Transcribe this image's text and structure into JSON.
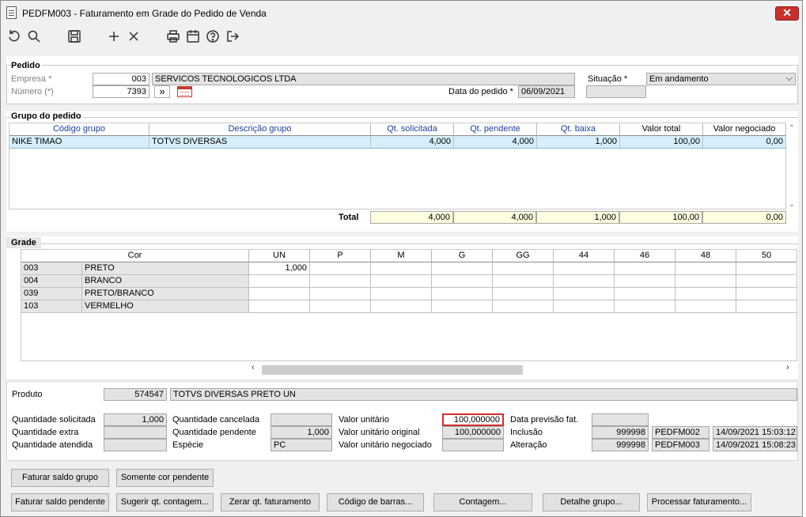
{
  "window": {
    "title": "PEDFM003 - Faturamento em Grade do Pedido de Venda",
    "close_label": "✕"
  },
  "toolbar": {
    "items": [
      "undo-icon",
      "search-icon",
      "save-icon",
      "add-icon",
      "delete-icon",
      "print-icon",
      "calendar-icon",
      "help-icon",
      "exit-icon"
    ]
  },
  "pedido": {
    "section_label": "Pedido",
    "empresa_label": "Empresa *",
    "empresa_code": "003",
    "empresa_name": "SERVICOS TECNOLOGICOS LTDA",
    "numero_label": "Número (*)",
    "numero_value": "7393",
    "nav_label": "»",
    "situacao_label": "Situação *",
    "situacao_value": "Em andamento",
    "data_label": "Data do pedido *",
    "data_value": "06/09/2021"
  },
  "grupo": {
    "section_label": "Grupo do pedido",
    "columns": [
      "Código grupo",
      "Descrição grupo",
      "Qt. solicitada",
      "Qt. pendente",
      "Qt. baixa",
      "Valor total",
      "Valor  negociado"
    ],
    "rows": [
      [
        "NIKE TIMAO",
        "TOTVS DIVERSAS",
        "4,000",
        "4,000",
        "1,000",
        "100,00",
        "0,00"
      ]
    ],
    "total_label": "Total",
    "totals": [
      "4,000",
      "4,000",
      "1,000",
      "100,00",
      "0,00"
    ]
  },
  "grade": {
    "section_label": "Grade",
    "cor_header": "Cor",
    "size_columns": [
      "UN",
      "P",
      "M",
      "G",
      "GG",
      "44",
      "46",
      "48",
      "50"
    ],
    "rows": [
      {
        "code": "003",
        "name": "PRETO",
        "un": "1,000"
      },
      {
        "code": "004",
        "name": "BRANCO",
        "un": ""
      },
      {
        "code": "039",
        "name": "PRETO/BRANCO",
        "un": ""
      },
      {
        "code": "103",
        "name": "VERMELHO",
        "un": ""
      }
    ]
  },
  "produto": {
    "label": "Produto",
    "code": "574547",
    "name": "TOTVS DIVERSAS PRETO UN"
  },
  "details": {
    "qt_solicitada_label": "Quantidade solicitada",
    "qt_solicitada": "1,000",
    "qt_extra_label": "Quantidade extra",
    "qt_extra": "",
    "qt_atendida_label": "Quantidade atendida",
    "qt_atendida": "",
    "qt_cancelada_label": "Quantidade cancelada",
    "qt_cancelada": "",
    "qt_pendente_label": "Quantidade pendente",
    "qt_pendente": "1,000",
    "especie_label": "Espécie",
    "especie": "PC",
    "vl_unitario_label": "Valor unitário",
    "vl_unitario": "100,000000",
    "vl_unit_original_label": "Valor unitário original",
    "vl_unit_original": "100,000000",
    "vl_unit_negociado_label": "Valor unitário negociado",
    "vl_unit_negociado": "",
    "data_prev_label": "Data previsão fat.",
    "data_prev": "",
    "inclusao_label": "Inclusão",
    "inclusao_user": "999998",
    "inclusao_prog": "PEDFM002",
    "inclusao_date": "14/09/2021 15:03:12",
    "alteracao_label": "Alteração",
    "alteracao_user": "999998",
    "alteracao_prog": "PEDFM003",
    "alteracao_date": "14/09/2021 15:08:23"
  },
  "buttons": {
    "faturar_saldo_grupo": "Faturar saldo grupo",
    "somente_cor_pendente": "Somente cor pendente",
    "faturar_saldo_pendente": "Faturar saldo pendente",
    "sugerir_qt": "Sugerir qt. contagem...",
    "zerar_qt": "Zerar qt. faturamento",
    "codigo_barras": "Código de barras...",
    "contagem": "Contagem...",
    "detalhe_grupo": "Detalhe grupo...",
    "processar": "Processar faturamento..."
  }
}
